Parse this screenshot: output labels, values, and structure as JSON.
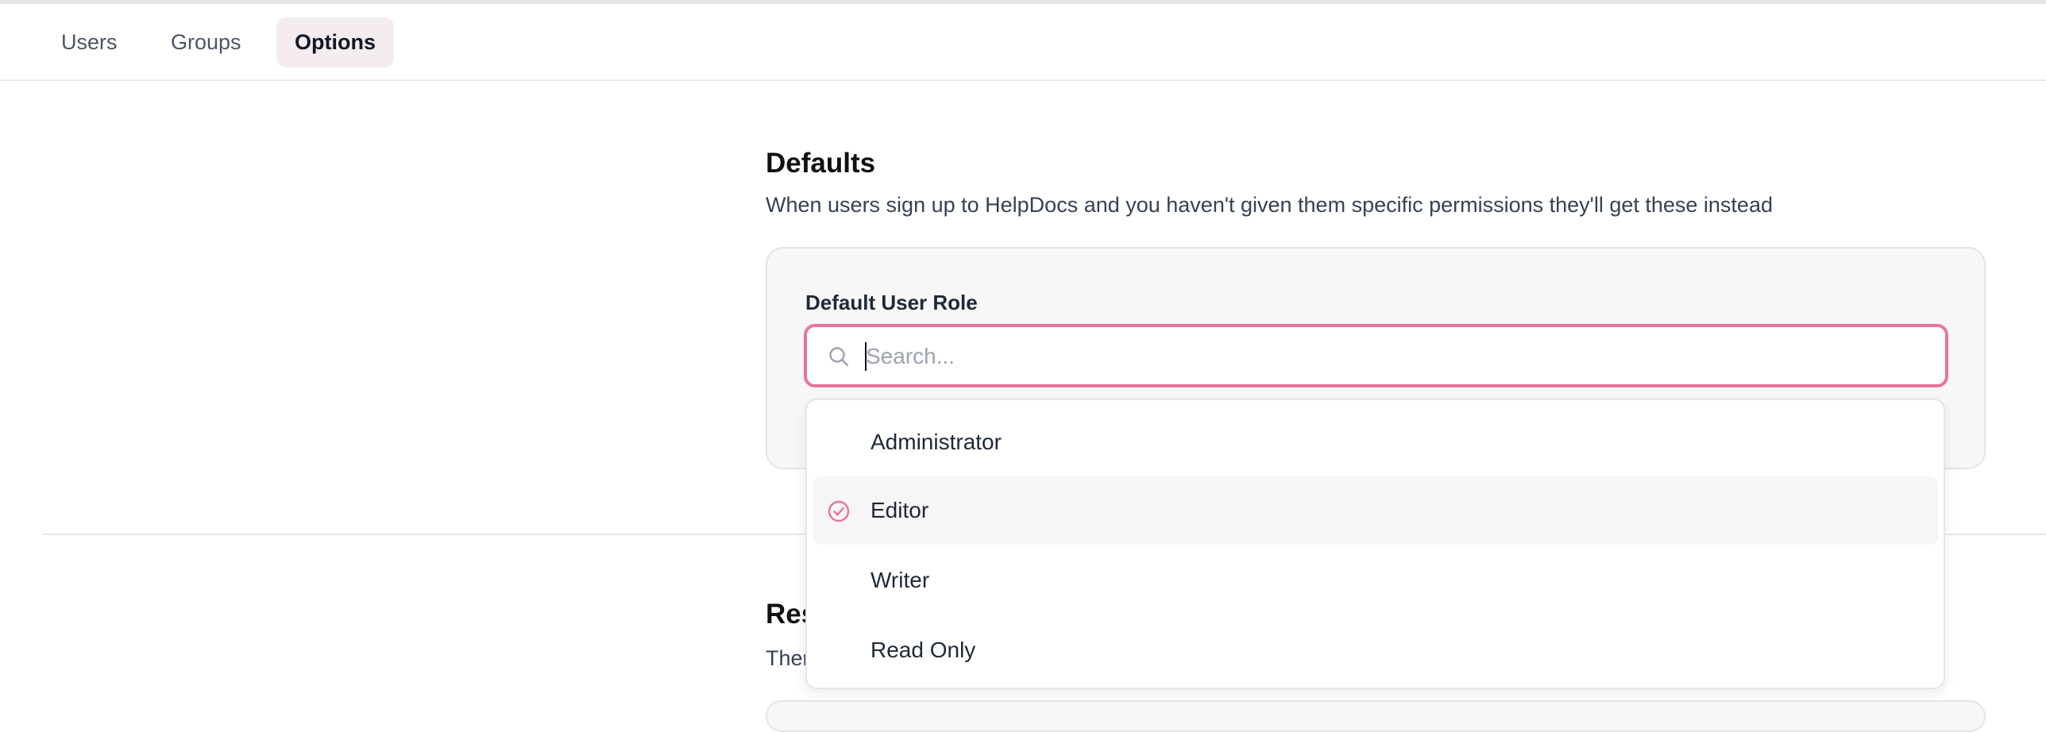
{
  "tabs": [
    {
      "label": "Users",
      "active": false
    },
    {
      "label": "Groups",
      "active": false
    },
    {
      "label": "Options",
      "active": true
    }
  ],
  "defaults": {
    "title": "Defaults",
    "description": "When users sign up to HelpDocs and you haven't given them specific permissions they'll get these instead",
    "field_label": "Default User Role",
    "search": {
      "placeholder": "Search...",
      "value": ""
    },
    "options": [
      {
        "label": "Administrator",
        "selected": false
      },
      {
        "label": "Editor",
        "selected": true
      },
      {
        "label": "Writer",
        "selected": false
      },
      {
        "label": "Read Only",
        "selected": false
      }
    ]
  },
  "section2": {
    "title_visible": "Res",
    "desc_visible": "Ther"
  },
  "colors": {
    "accent": "#e8739f",
    "active_tab_bg": "#f4ecee",
    "selected_option_bg": "#f8f5f6"
  },
  "icons": {
    "search": "search-icon",
    "selected": "check-circle-icon"
  }
}
